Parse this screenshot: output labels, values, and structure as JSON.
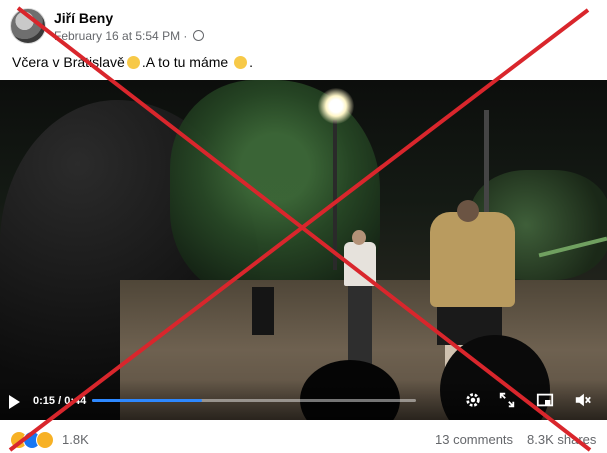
{
  "post": {
    "author": "Jiří Beny",
    "date": "February 16 at 5:54 PM",
    "text_part1": "Včera v Bratislavě",
    "text_part2": ".A to tu máme",
    "text_end": "."
  },
  "video": {
    "current_time": "0:15",
    "separator": "/",
    "duration": "0:44",
    "progress": 0.34
  },
  "footer": {
    "reaction_count": "1.8K",
    "comments": "13 comments",
    "shares": "8.3K shares"
  },
  "icons": {
    "reactions": [
      "haha-icon",
      "like-icon",
      "wow-icon"
    ],
    "controls": [
      "play-icon",
      "settings-icon",
      "expand-icon",
      "miniplayer-icon",
      "volume-muted-icon"
    ],
    "overlay": "red-x-cross"
  },
  "colors": {
    "overlay_cross": "#d9262c",
    "progress_fill": "#2d88ff",
    "like_blue": "#1877f2"
  }
}
